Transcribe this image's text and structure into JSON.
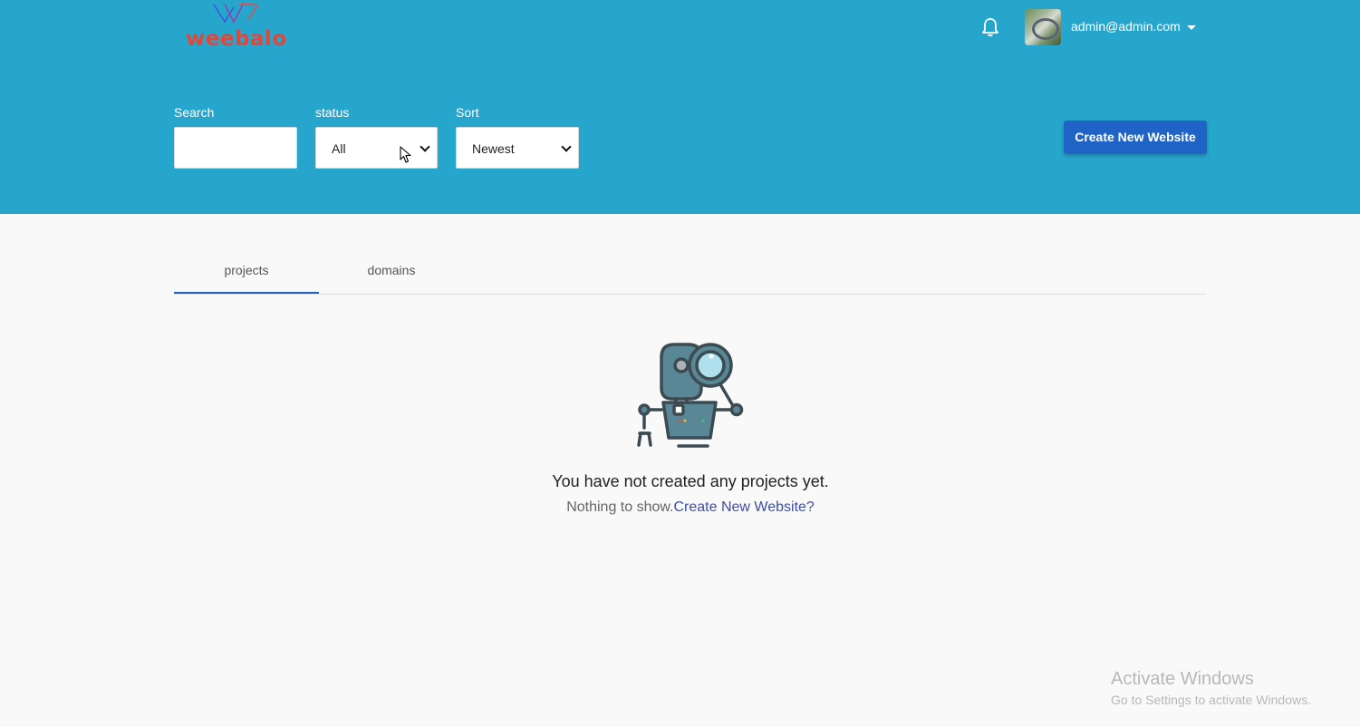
{
  "brand": {
    "name": "weebalo",
    "color": "#e0483c"
  },
  "header": {
    "background": "#27a6cd",
    "user_email": "admin@admin.com",
    "notification_icon": "bell-icon",
    "avatar_icon": "avatar-image"
  },
  "filters": {
    "search": {
      "label": "Search",
      "value": ""
    },
    "status": {
      "label": "status",
      "value": "All"
    },
    "sort": {
      "label": "Sort",
      "value": "Newest"
    }
  },
  "actions": {
    "create_label": "Create New Website",
    "create_color": "#1f63c6"
  },
  "tabs": [
    {
      "label": "projects",
      "active": true
    },
    {
      "label": "domains",
      "active": false
    }
  ],
  "empty_state": {
    "illustration": "robot-magnifier-icon",
    "title": "You have not created any projects yet.",
    "subtitle": "Nothing to show.",
    "link": "Create New Website?"
  },
  "watermark": {
    "line1": "Activate Windows",
    "line2": "Go to Settings to activate Windows."
  }
}
